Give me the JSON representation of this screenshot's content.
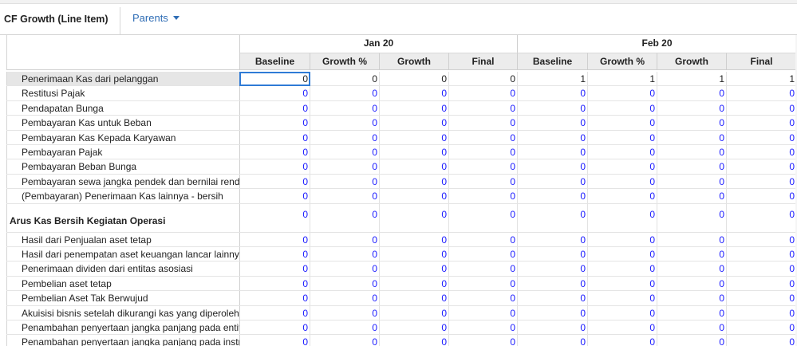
{
  "toolbar": {
    "title": "CF Growth (Line Item)",
    "parents_label": "Parents"
  },
  "periods": [
    "Jan 20",
    "Feb 20"
  ],
  "columns": [
    "Baseline",
    "Growth %",
    "Growth",
    "Final",
    "Baseline",
    "Growth %",
    "Growth",
    "Final"
  ],
  "rows": [
    {
      "label": "Penerimaan Kas dari pelanggan",
      "values": [
        "0",
        "0",
        "0",
        "0",
        "1",
        "1",
        "1",
        "1"
      ],
      "selected": true,
      "dark": true
    },
    {
      "label": "Restitusi Pajak",
      "values": [
        "0",
        "0",
        "0",
        "0",
        "0",
        "0",
        "0",
        "0"
      ]
    },
    {
      "label": "Pendapatan Bunga",
      "values": [
        "0",
        "0",
        "0",
        "0",
        "0",
        "0",
        "0",
        "0"
      ]
    },
    {
      "label": "Pembayaran Kas untuk Beban",
      "values": [
        "0",
        "0",
        "0",
        "0",
        "0",
        "0",
        "0",
        "0"
      ]
    },
    {
      "label": "Pembayaran Kas Kepada Karyawan",
      "values": [
        "0",
        "0",
        "0",
        "0",
        "0",
        "0",
        "0",
        "0"
      ]
    },
    {
      "label": "Pembayaran Pajak",
      "values": [
        "0",
        "0",
        "0",
        "0",
        "0",
        "0",
        "0",
        "0"
      ]
    },
    {
      "label": "Pembayaran Beban Bunga",
      "values": [
        "0",
        "0",
        "0",
        "0",
        "0",
        "0",
        "0",
        "0"
      ]
    },
    {
      "label": "Pembayaran sewa jangka pendek dan bernilai rendah",
      "values": [
        "0",
        "0",
        "0",
        "0",
        "0",
        "0",
        "0",
        "0"
      ]
    },
    {
      "label": "(Pembayaran) Penerimaan Kas lainnya - bersih",
      "values": [
        "0",
        "0",
        "0",
        "0",
        "0",
        "0",
        "0",
        "0"
      ]
    },
    {
      "label": "Arus Kas Bersih Kegiatan Operasi",
      "values": [
        "0",
        "0",
        "0",
        "0",
        "0",
        "0",
        "0",
        "0"
      ],
      "section": true
    },
    {
      "label": "Hasil dari Penjualan aset tetap",
      "values": [
        "0",
        "0",
        "0",
        "0",
        "0",
        "0",
        "0",
        "0"
      ]
    },
    {
      "label": "Hasil dari penempatan aset keuangan lancar lainnya",
      "values": [
        "0",
        "0",
        "0",
        "0",
        "0",
        "0",
        "0",
        "0"
      ]
    },
    {
      "label": "Penerimaan dividen dari entitas asosiasi",
      "values": [
        "0",
        "0",
        "0",
        "0",
        "0",
        "0",
        "0",
        "0"
      ]
    },
    {
      "label": "Pembelian aset tetap",
      "values": [
        "0",
        "0",
        "0",
        "0",
        "0",
        "0",
        "0",
        "0"
      ]
    },
    {
      "label": "Pembelian Aset Tak Berwujud",
      "values": [
        "0",
        "0",
        "0",
        "0",
        "0",
        "0",
        "0",
        "0"
      ]
    },
    {
      "label": "Akuisisi bisnis setelah dikurangi kas yang diperoleh",
      "values": [
        "0",
        "0",
        "0",
        "0",
        "0",
        "0",
        "0",
        "0"
      ]
    },
    {
      "label": "Penambahan penyertaan jangka panjang pada entitas",
      "values": [
        "0",
        "0",
        "0",
        "0",
        "0",
        "0",
        "0",
        "0"
      ]
    },
    {
      "label": "Penambahan penyertaan jangka panjang pada instrumen",
      "values": [
        "0",
        "0",
        "0",
        "0",
        "0",
        "0",
        "0",
        "0"
      ]
    }
  ]
}
